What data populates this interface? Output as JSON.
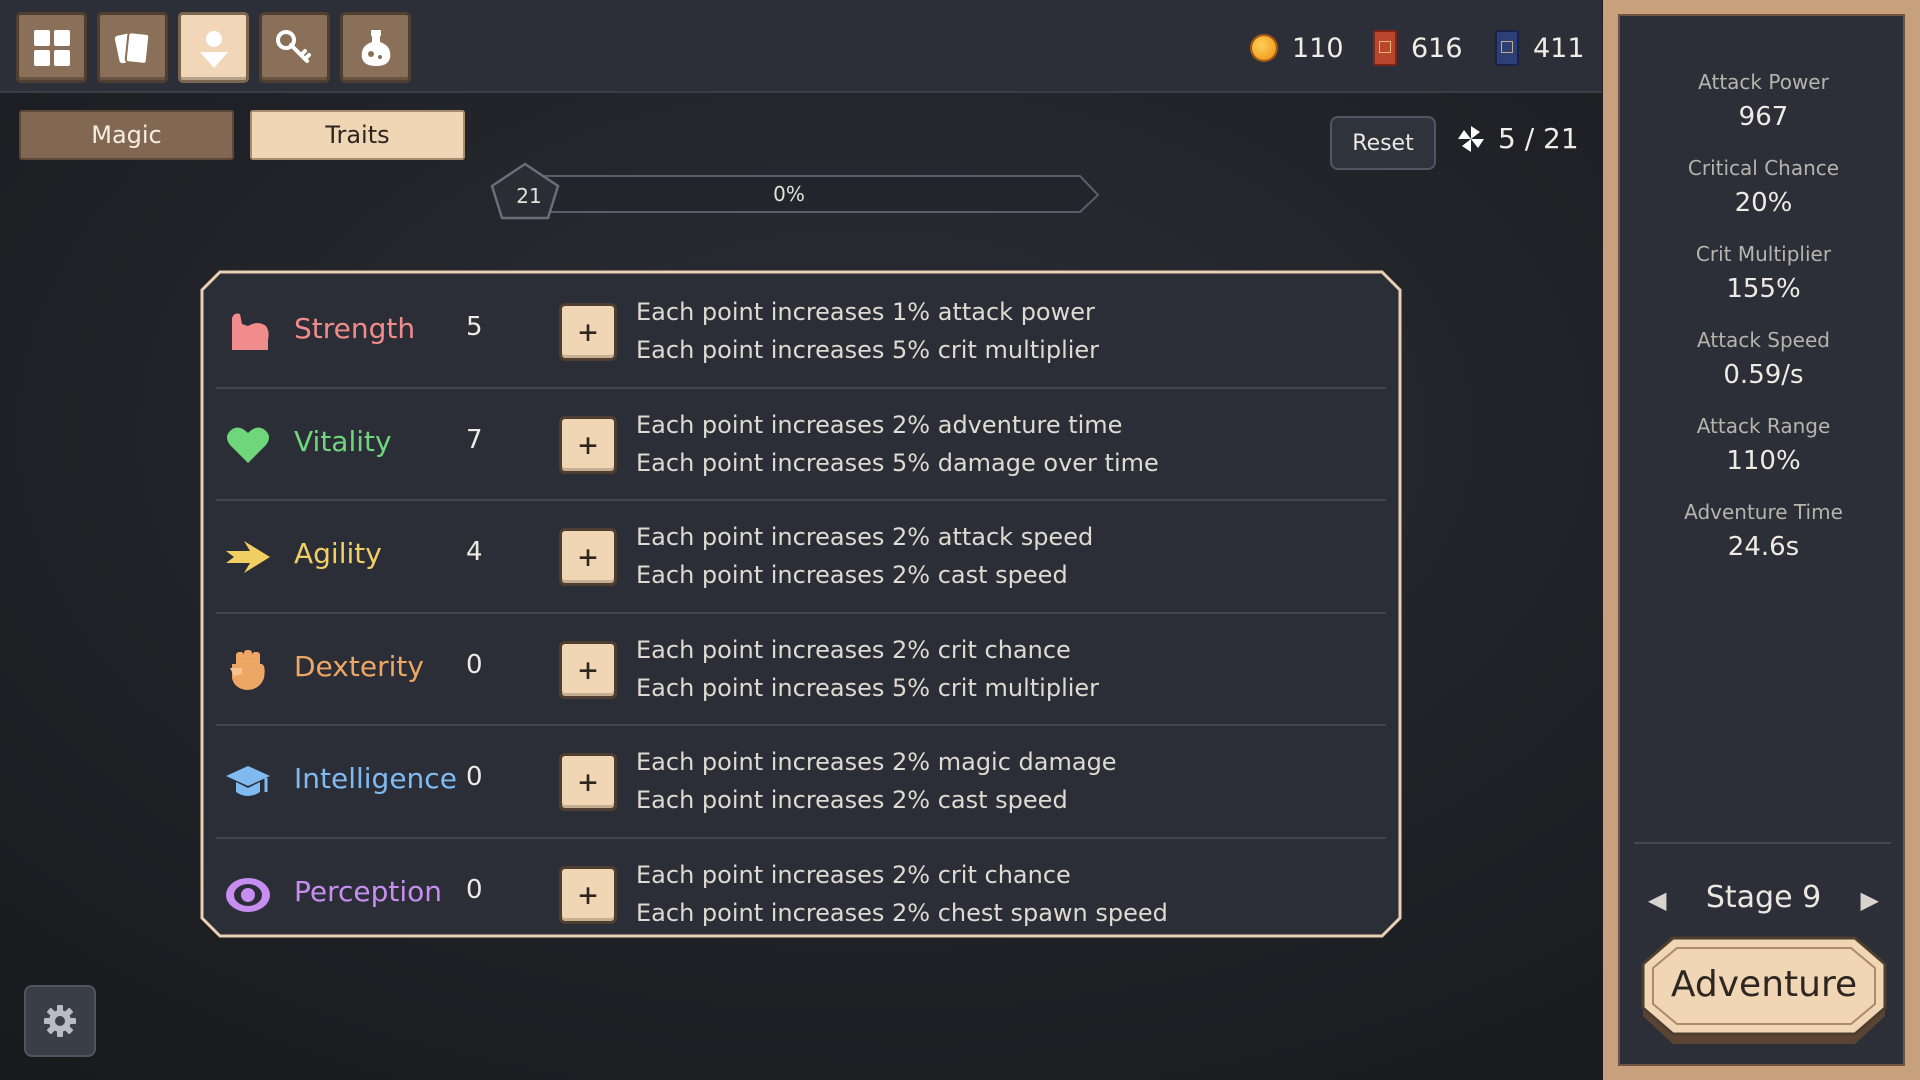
{
  "nav": [
    {
      "name": "inventory-grid-icon",
      "active": false
    },
    {
      "name": "cards-icon",
      "active": false
    },
    {
      "name": "character-icon",
      "active": true
    },
    {
      "name": "keys-icon",
      "active": false
    },
    {
      "name": "potion-icon",
      "active": false
    }
  ],
  "currency": {
    "coins": "110",
    "red_books": "616",
    "blue_books": "411"
  },
  "tabs": {
    "magic": "Magic",
    "traits": "Traits"
  },
  "reset_label": "Reset",
  "points": "5 / 21",
  "level": {
    "number": "21",
    "progress_label": "0%",
    "progress": 0
  },
  "traits": [
    {
      "name": "Strength",
      "value": "5",
      "color": "#f08c8c",
      "icon": "flexed-arm-icon",
      "desc1": "Each point increases 1% attack power",
      "desc2": "Each point increases 5% crit multiplier"
    },
    {
      "name": "Vitality",
      "value": "7",
      "color": "#6fd67b",
      "icon": "heart-icon",
      "desc1": "Each point increases 2% adventure time",
      "desc2": "Each point increases 5% damage over time"
    },
    {
      "name": "Agility",
      "value": "4",
      "color": "#f2cf63",
      "icon": "arrow-right-icon",
      "desc1": "Each point increases 2% attack speed",
      "desc2": "Each point increases 2% cast speed"
    },
    {
      "name": "Dexterity",
      "value": "0",
      "color": "#eea665",
      "icon": "fist-icon",
      "desc1": "Each point increases 2% crit chance",
      "desc2": "Each point increases 5% crit multiplier"
    },
    {
      "name": "Intelligence",
      "value": "0",
      "color": "#7fbaf1",
      "icon": "graduation-cap-icon",
      "desc1": "Each point increases 2% magic damage",
      "desc2": "Each point increases 2% cast speed"
    },
    {
      "name": "Perception",
      "value": "0",
      "color": "#c58ef0",
      "icon": "eye-icon",
      "desc1": "Each point increases 2% crit chance",
      "desc2": "Each point increases 2% chest spawn speed"
    }
  ],
  "plus_label": "+",
  "stats": [
    {
      "label": "Attack Power",
      "value": "967"
    },
    {
      "label": "Critical Chance",
      "value": "20%"
    },
    {
      "label": "Crit Multiplier",
      "value": "155%"
    },
    {
      "label": "Attack Speed",
      "value": "0.59/s"
    },
    {
      "label": "Attack Range",
      "value": "110%"
    },
    {
      "label": "Adventure Time",
      "value": "24.6s"
    }
  ],
  "stage": "Stage 9",
  "adventure_label": "Adventure"
}
